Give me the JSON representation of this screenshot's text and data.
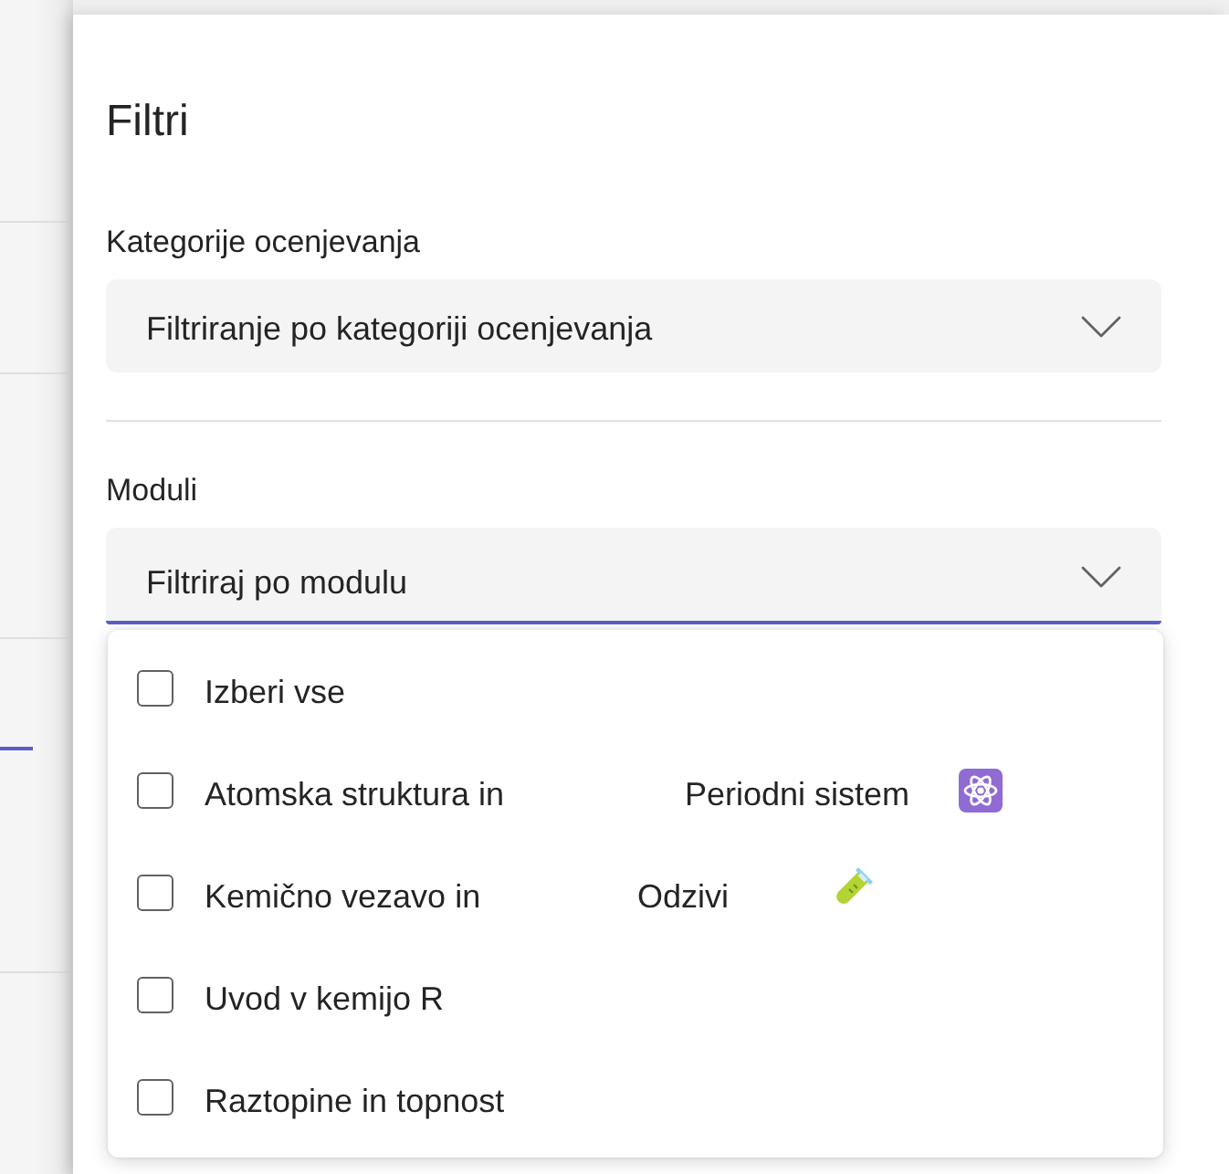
{
  "panel": {
    "title": "Filtri"
  },
  "filters": [
    {
      "label": "Kategorije ocenjevanja",
      "placeholder": "Filtriranje po kategoriji ocenjevanja",
      "expanded": false
    },
    {
      "label": "Moduli",
      "placeholder": "Filtriraj po modulu",
      "expanded": true,
      "options": [
        {
          "kind": "plain",
          "segments": [
            "Izberi vse"
          ],
          "checked": false
        },
        {
          "kind": "atom",
          "segments": [
            "Atomska struktura in",
            "Periodni sistem"
          ],
          "checked": false
        },
        {
          "kind": "tube",
          "segments": [
            "Kemično vezavo in",
            "Odzivi"
          ],
          "checked": false
        },
        {
          "kind": "plain",
          "segments": [
            "Uvod v kemijo R"
          ],
          "checked": false
        },
        {
          "kind": "plain",
          "segments": [
            "Raztopine in topnost"
          ],
          "checked": false
        }
      ]
    }
  ]
}
